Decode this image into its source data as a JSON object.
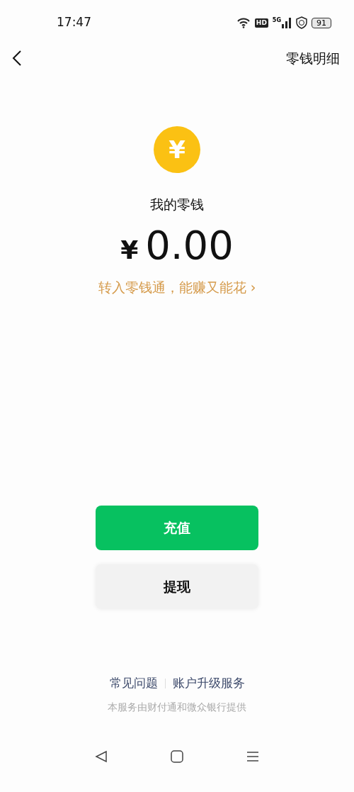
{
  "status_bar": {
    "time": "17:47",
    "network_badge": "HD",
    "signal_label": "5G",
    "battery": "91"
  },
  "nav": {
    "action": "零钱明细"
  },
  "balance": {
    "coin_symbol": "¥",
    "label": "我的零钱",
    "currency": "¥",
    "amount": "0.00",
    "promo": "转入零钱通，能赚又能花",
    "promo_arrow": "›"
  },
  "buttons": [
    {
      "label": "充值",
      "kind": "primary"
    },
    {
      "label": "提现",
      "kind": "secondary"
    }
  ],
  "footer": {
    "links": [
      "常见问题",
      "账户升级服务"
    ],
    "note": "本服务由财付通和微众银行提供"
  }
}
